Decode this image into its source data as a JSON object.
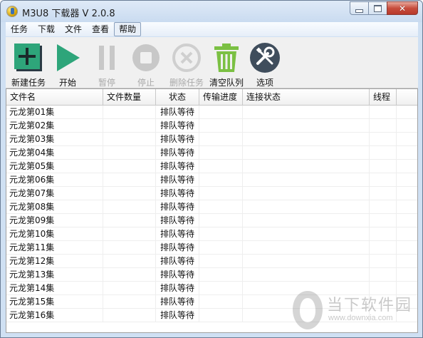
{
  "window": {
    "title": "M3U8 下载器 V 2.0.8"
  },
  "menu": [
    "任务",
    "下载",
    "文件",
    "查看",
    "帮助"
  ],
  "toolbar": [
    {
      "label": "新建任务",
      "icon": "new-task-icon",
      "enabled": true
    },
    {
      "label": "开始",
      "icon": "play-icon",
      "enabled": true
    },
    {
      "label": "暂停",
      "icon": "pause-icon",
      "enabled": false
    },
    {
      "label": "停止",
      "icon": "stop-icon",
      "enabled": false
    },
    {
      "label": "删除任务",
      "icon": "delete-task-icon",
      "enabled": false
    },
    {
      "label": "清空队列",
      "icon": "trash-icon",
      "enabled": true
    },
    {
      "label": "选项",
      "icon": "tools-icon",
      "enabled": true
    }
  ],
  "table": {
    "columns": [
      "文件名",
      "文件数量",
      "状态",
      "传输进度",
      "连接状态",
      "线程"
    ],
    "rows": [
      [
        "元龙第01集",
        "",
        "排队等待",
        "",
        "",
        ""
      ],
      [
        "元龙第02集",
        "",
        "排队等待",
        "",
        "",
        ""
      ],
      [
        "元龙第03集",
        "",
        "排队等待",
        "",
        "",
        ""
      ],
      [
        "元龙第04集",
        "",
        "排队等待",
        "",
        "",
        ""
      ],
      [
        "元龙第05集",
        "",
        "排队等待",
        "",
        "",
        ""
      ],
      [
        "元龙第06集",
        "",
        "排队等待",
        "",
        "",
        ""
      ],
      [
        "元龙第07集",
        "",
        "排队等待",
        "",
        "",
        ""
      ],
      [
        "元龙第08集",
        "",
        "排队等待",
        "",
        "",
        ""
      ],
      [
        "元龙第09集",
        "",
        "排队等待",
        "",
        "",
        ""
      ],
      [
        "元龙第10集",
        "",
        "排队等待",
        "",
        "",
        ""
      ],
      [
        "元龙第11集",
        "",
        "排队等待",
        "",
        "",
        ""
      ],
      [
        "元龙第12集",
        "",
        "排队等待",
        "",
        "",
        ""
      ],
      [
        "元龙第13集",
        "",
        "排队等待",
        "",
        "",
        ""
      ],
      [
        "元龙第14集",
        "",
        "排队等待",
        "",
        "",
        ""
      ],
      [
        "元龙第15集",
        "",
        "排队等待",
        "",
        "",
        ""
      ],
      [
        "元龙第16集",
        "",
        "排队等待",
        "",
        "",
        ""
      ]
    ]
  },
  "watermark": {
    "name": "当下软件园",
    "url": "www.downxia.com"
  },
  "colors": {
    "accent_green": "#2ea57a",
    "trash_green": "#7bc043",
    "disabled_gray": "#c8c8c8",
    "tools_dark": "#3f4d5c"
  }
}
